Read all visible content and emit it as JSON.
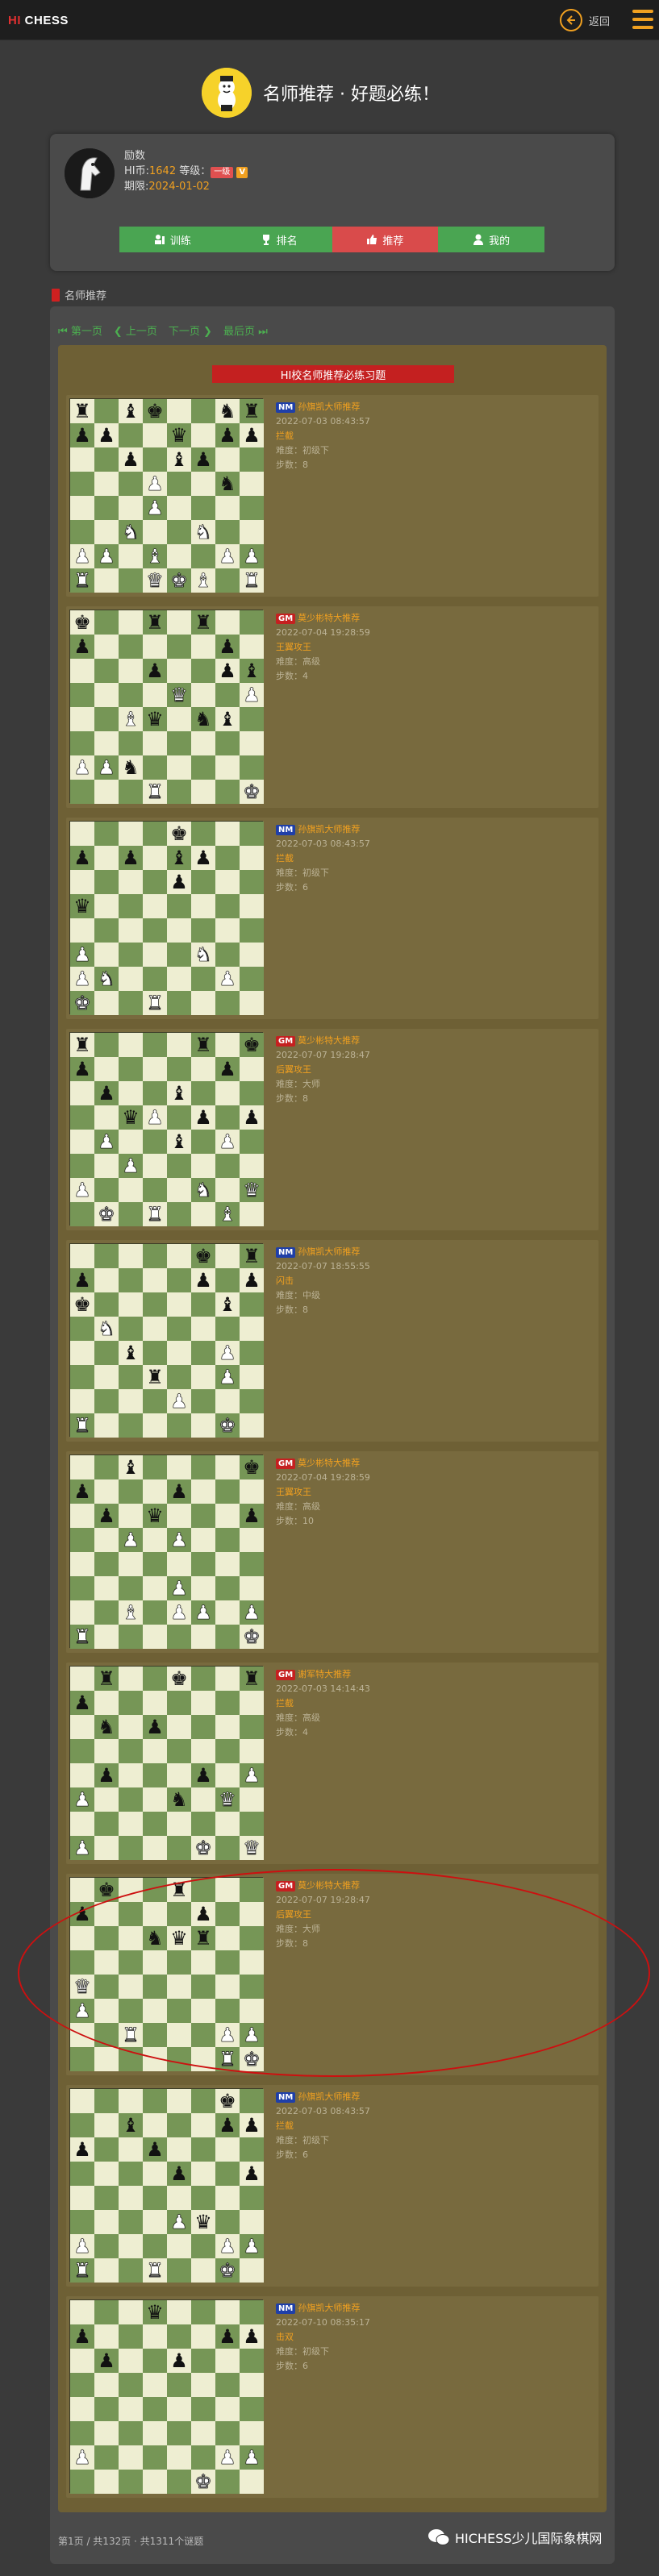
{
  "topbar": {
    "logo_hi": "HI",
    "logo_rest": " CHESS",
    "back_label": "返回",
    "back_icon": "arrow-left-circle-icon",
    "menu_icon": "hamburger-icon"
  },
  "hero": {
    "title": "名师推荐 · 好题必练！"
  },
  "user": {
    "name": "励数",
    "coins_label": "HI币:",
    "coins": "1642",
    "level_label": "等级：",
    "level_badge": "一级",
    "vip_badge": "V",
    "expiry_label": "期限:",
    "expiry": "2024-01-02"
  },
  "tabs": [
    {
      "label": "训练",
      "icon": "training-icon"
    },
    {
      "label": "排名",
      "icon": "trophy-icon"
    },
    {
      "label": "推荐",
      "icon": "thumbs-up-icon"
    },
    {
      "label": "我的",
      "icon": "user-icon"
    }
  ],
  "section": {
    "label": "名师推荐"
  },
  "pager": {
    "first": "第一页",
    "prev": "上一页",
    "next": "下一页",
    "last": "最后页"
  },
  "list_heading": "HI校名师推荐必练习题",
  "puzzles": [
    {
      "rank": "NM",
      "teacher": "孙旗凯大师推荐",
      "date": "2022-07-03 08:43:57",
      "theme": "拦截",
      "difficulty": "难度：初级下",
      "steps": "步数：8",
      "board": [
        "r.bk..nr",
        "pp..q.pp",
        "..p.bp..",
        "...P..n.",
        "...P....",
        "..N..N..",
        "PP.B..PP",
        "R..QKB.R"
      ]
    },
    {
      "rank": "GM",
      "teacher": "莫少彬特大推荐",
      "date": "2022-07-04 19:28:59",
      "theme": "王翼攻王",
      "difficulty": "难度：高级",
      "steps": "步数：4",
      "board": [
        "k..r.r..",
        "p.....p.",
        "...p..pb",
        "....Q..P",
        "..Bq.nb.",
        "........",
        "PPn.....",
        "...R...K"
      ]
    },
    {
      "rank": "NM",
      "teacher": "孙旗凯大师推荐",
      "date": "2022-07-03 08:43:57",
      "theme": "拦截",
      "difficulty": "难度：初级下",
      "steps": "步数：6",
      "board": [
        "....k...",
        "p.p.bp..",
        "....p...",
        "q.......",
        "........",
        "P....N..",
        "PN....P.",
        "K..R...."
      ]
    },
    {
      "rank": "GM",
      "teacher": "莫少彬特大推荐",
      "date": "2022-07-07 19:28:47",
      "theme": "后翼攻王",
      "difficulty": "难度：大师",
      "steps": "步数：8",
      "board": [
        "r....r.k",
        "p.....p.",
        ".p..b...",
        "..qP.p.p",
        ".P..b.P.",
        "..P.....",
        "P....N.Q",
        ".K.R..B."
      ]
    },
    {
      "rank": "NM",
      "teacher": "孙旗凯大师推荐",
      "date": "2022-07-07 18:55:55",
      "theme": "闪击",
      "difficulty": "难度：中级",
      "steps": "步数：8",
      "board": [
        ".....k.r",
        "p....p.p",
        "k.....b.",
        ".N......",
        "..b...P.",
        "...r..P.",
        "....P...",
        "R.....K."
      ]
    },
    {
      "rank": "GM",
      "teacher": "莫少彬特大推荐",
      "date": "2022-07-04 19:28:59",
      "theme": "王翼攻王",
      "difficulty": "难度：高级",
      "steps": "步数：10",
      "board": [
        "..b....k",
        "p...p...",
        ".p.q...p",
        "..P.P...",
        "........",
        "....P...",
        "..B.PP.P",
        "R......K"
      ]
    },
    {
      "rank": "GM",
      "teacher": "谢军特大推荐",
      "date": "2022-07-03 14:14:43",
      "theme": "拦截",
      "difficulty": "难度：高级",
      "steps": "步数：4",
      "board": [
        ".r..k..r",
        "p.......",
        ".n.p....",
        "........",
        ".p...p.P",
        "P...n.Q.",
        "........",
        "P....K.Q"
      ]
    },
    {
      "rank": "GM",
      "teacher": "莫少彬特大推荐",
      "date": "2022-07-07 19:28:47",
      "theme": "后翼攻王",
      "difficulty": "难度：大师",
      "steps": "步数：8",
      "board": [
        ".k..r...",
        "p....p..",
        "...nqr..",
        "........",
        "Q.......",
        "P.......",
        "..R...PP",
        "......RK"
      ]
    },
    {
      "rank": "NM",
      "teacher": "孙旗凯大师推荐",
      "date": "2022-07-03 08:43:57",
      "theme": "拦截",
      "difficulty": "难度：初级下",
      "steps": "步数：6",
      "board": [
        "......k.",
        "..b...pp",
        "p..p....",
        "....p..p",
        "........",
        "....Pq..",
        "P.....PP",
        "R..R..K."
      ]
    },
    {
      "rank": "NM",
      "teacher": "孙旗凯大师推荐",
      "date": "2022-07-10 08:35:17",
      "theme": "击双",
      "difficulty": "难度：初级下",
      "steps": "步数：6",
      "board": [
        "...q....",
        "p.....pp",
        ".p..p...",
        "........",
        "........",
        "........",
        "P.....PP",
        ".....K.."
      ]
    }
  ],
  "footer": {
    "summary": "第1页 / 共132页 · 共1311个谜题"
  },
  "watermark": {
    "text": "HICHESS少儿国际象棋网"
  },
  "colors": {
    "accent": "#f0a020",
    "tab_green": "#4aa552",
    "tab_active": "#d94b4b",
    "board_light": "#eeeed2",
    "board_dark": "#769656",
    "annotation_red": "#cc1010"
  }
}
